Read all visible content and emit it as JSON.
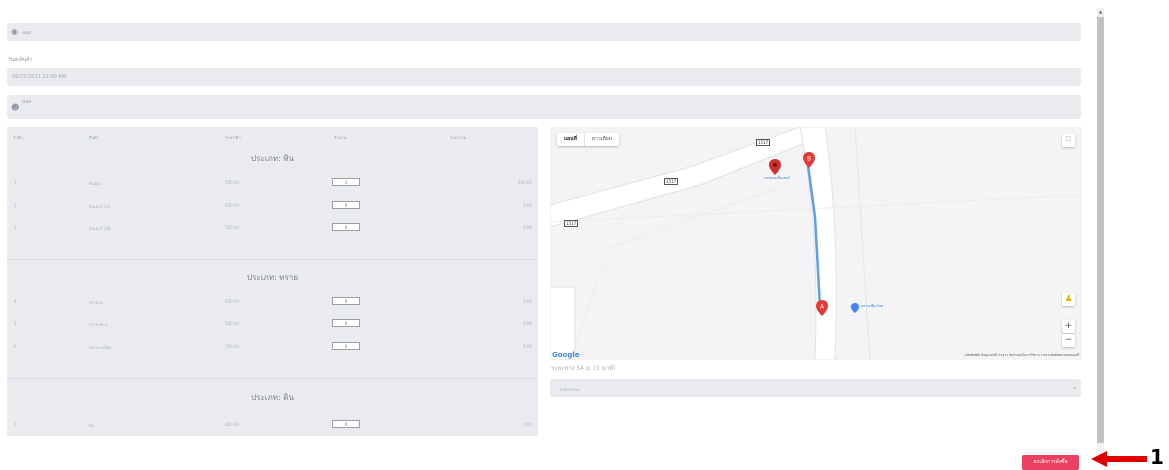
{
  "top_field": {
    "icon": "camera-icon",
    "value": "aaa"
  },
  "date_field": {
    "label": "วันส่งสินค้า",
    "value": "09/25/2021 12:00 AM"
  },
  "person_field": {
    "icon": "user-icon",
    "value": "aaa"
  },
  "table": {
    "headers": [
      "ลำดับ",
      "สินค้า",
      "ราคา/คิว",
      "จำนวน",
      "ราคารวม"
    ],
    "sections": [
      {
        "title": "ประเภท: หิน",
        "rows": [
          {
            "no": "1",
            "name": "หินคลุก",
            "price": "500.00",
            "qty": "1",
            "total": "500.00"
          },
          {
            "no": "2",
            "name": "หินเบอร์ 3/4",
            "price": "600.00",
            "qty": "0",
            "total": "0.00"
          },
          {
            "no": "3",
            "name": "หินเบอร์ 3/8",
            "price": "700.00",
            "qty": "0",
            "total": "0.00"
          }
        ]
      },
      {
        "title": "ประเภท: ทราย",
        "rows": [
          {
            "no": "4",
            "name": "ทรายถม",
            "price": "600.00",
            "qty": "0",
            "total": "0.00"
          },
          {
            "no": "5",
            "name": "ทรายหยาบ",
            "price": "500.00",
            "qty": "0",
            "total": "0.00"
          },
          {
            "no": "6",
            "name": "ทรายละเอียด",
            "price": "700.00",
            "qty": "0",
            "total": "0.00"
          }
        ]
      },
      {
        "title": "ประเภท: ดิน",
        "rows": [
          {
            "no": "7",
            "name": "ดิน",
            "price": "400.00",
            "qty": "0",
            "total": "0.00"
          }
        ]
      }
    ]
  },
  "map": {
    "type_map": "แผนที่",
    "type_satellite": "ดาวเทียม",
    "road_label": "1517",
    "poi_top": "แสงทองเซ็นเตอร์",
    "poi_right": "ตลาดเชียงใหม่",
    "marker_a": "A",
    "marker_b": "B",
    "google": "Google",
    "attribution": "แป้นพิมพ์ลัด  ข้อมูลแผนที่ ©2021  ข้อกำหนดในการใช้งาน  รายงานข้อผิดพลาดของแผนที่",
    "zoom_in": "+",
    "zoom_out": "−",
    "fullscreen_icon": "fullscreen-icon",
    "pegman_icon": "pegman-icon"
  },
  "distance": "ระยะทาง 54 ม. (1 นาที)",
  "vehicle_select": {
    "value": "รถบัสกระบะ"
  },
  "submit_label": "ยกเลิกการสั่งซื้อ",
  "annotation_number": "1",
  "colors": {
    "accent": "#e8405e",
    "panel": "#e9ebef",
    "route": "#5b9fe8",
    "marker": "#e53935"
  }
}
